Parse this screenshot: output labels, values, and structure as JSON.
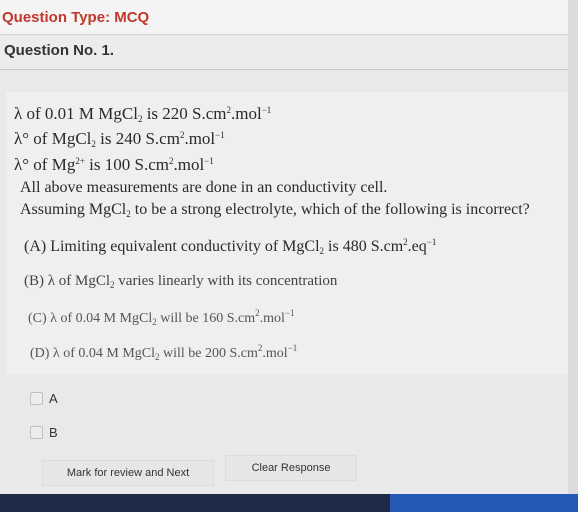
{
  "header": {
    "question_type": "Question Type: MCQ"
  },
  "question_number": "Question No. 1.",
  "question": {
    "line1": {
      "pre": "λ of 0.01 M MgCl",
      "sub": "2",
      "mid": " is 220 S.cm",
      "sup1": "2",
      "post": ".mol",
      "sup2": "−1"
    },
    "line2": {
      "pre": "λ° of MgCl",
      "sub": "2",
      "mid": " is 240 S.cm",
      "sup1": "2",
      "post": ".mol",
      "sup2": "−1"
    },
    "line3": {
      "pre": "λ° of Mg",
      "sup0": "2+",
      "mid": " is 100 S.cm",
      "sup1": "2",
      "post": ".mol",
      "sup2": "−1"
    },
    "line4": "All above measurements are done in an conductivity cell.",
    "line5": {
      "pre": "Assuming MgCl",
      "sub": "2",
      "post": " to be a strong electrolyte, which of the following is incorrect?"
    }
  },
  "options": {
    "A": {
      "pre": "(A)  Limiting equivalent conductivity of MgCl",
      "sub": "2",
      "mid": " is 480 S.cm",
      "sup1": "2",
      "post": ".eq",
      "sup2": "−1"
    },
    "B": {
      "pre": "(B)  λ of MgCl",
      "sub": "2",
      "post": " varies linearly with its concentration"
    },
    "C": {
      "pre": "(C)  λ of 0.04 M MgCl",
      "sub": "2",
      "mid": " will be 160 S.cm",
      "sup1": "2",
      "post": ".mol",
      "sup2": "−1"
    },
    "D": {
      "pre": "(D)  λ of 0.04 M MgCl",
      "sub": "2",
      "mid": " will be 200 S.cm",
      "sup1": "2",
      "post": ".mol",
      "sup2": "−1"
    }
  },
  "answer_choices": [
    "A",
    "B"
  ],
  "buttons": {
    "mark_review": "Mark for review and Next",
    "clear": "Clear Response"
  },
  "colors": {
    "accent": "#c0392b",
    "taskbar": "#1e2a47",
    "taskbar_highlight": "#2459b8"
  }
}
